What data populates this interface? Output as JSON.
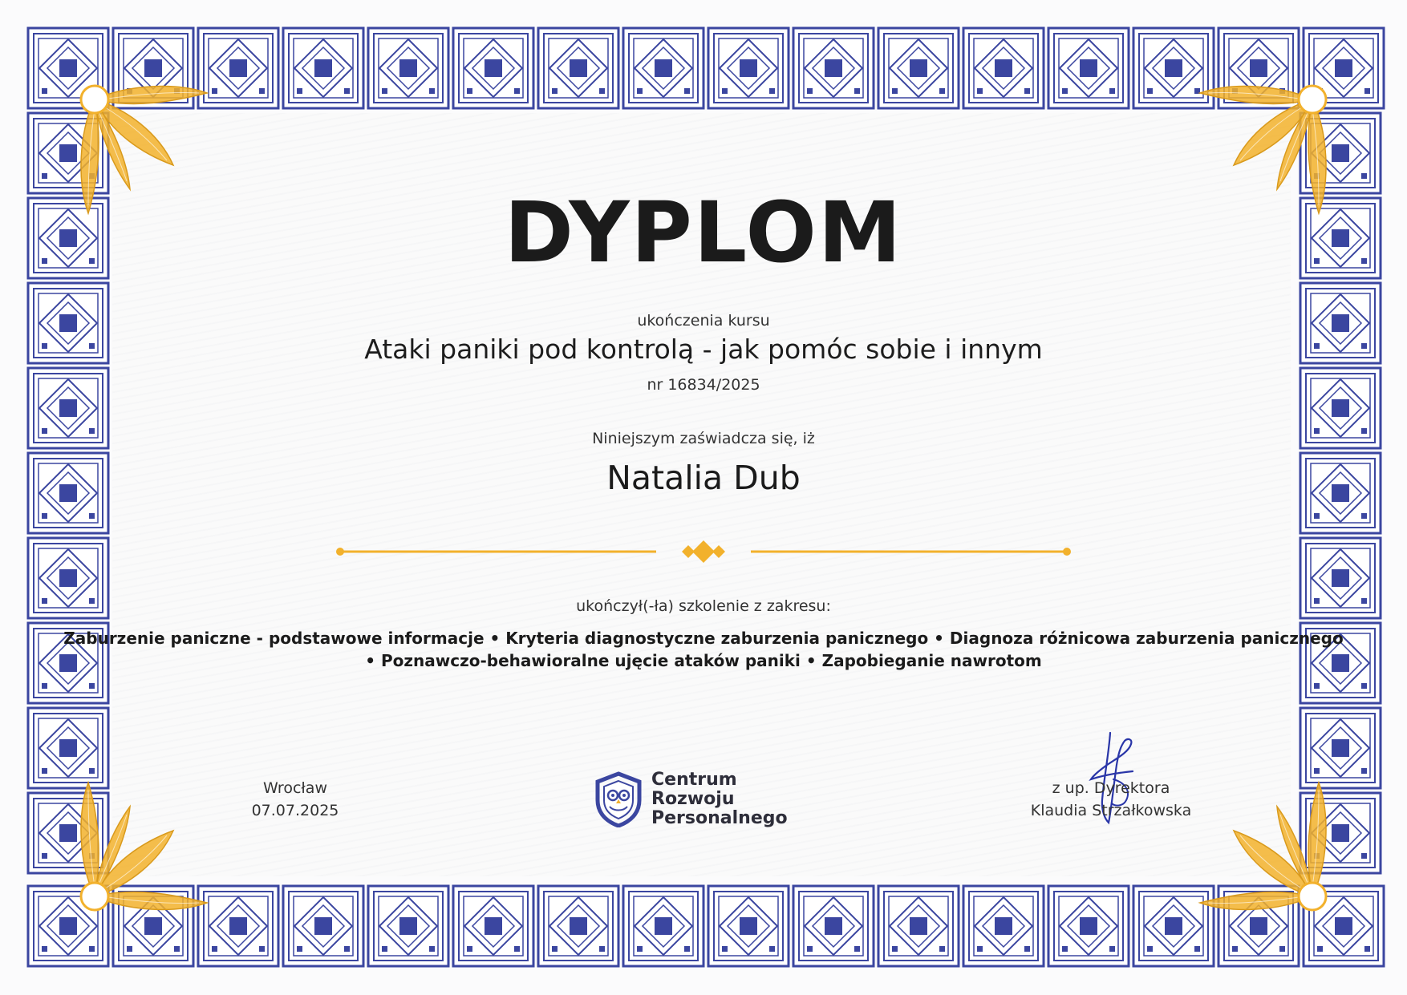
{
  "certificate": {
    "title": "DYPLOM",
    "course_label": "ukończenia kursu",
    "course_name": "Ataki paniki pod kontrolą - jak pomóc sobie i innym",
    "number": "nr 16834/2025",
    "certify_label": "Niniejszym zaświadcza się, iż",
    "recipient_name": "Natalia Dub",
    "completed_label": "ukończył(-ła) szkolenie z zakresu:",
    "topics_line1": "Zaburzenie paniczne - podstawowe informacje • Kryteria diagnostyczne zaburzenia panicznego • Diagnoza różnicowa zaburzenia panicznego",
    "topics_line2": "• Poznawczo-behawioralne ujęcie ataków paniki • Zapobieganie nawrotom"
  },
  "footer": {
    "city": "Wrocław",
    "date": "07.07.2025",
    "org_line1": "Centrum Rozwoju",
    "org_line2": "Personalnego",
    "signatory_role": "z up. Dyrektora",
    "signatory_name": "Klaudia Strzałkowska"
  },
  "colors": {
    "border_blue": "#3b46a0",
    "accent_gold": "#f2b12c",
    "text_dark": "#1b1b1b"
  },
  "icons": {
    "border_tile": "geometric-square-tile-icon",
    "corner": "golden-leaf-flower-icon",
    "logo": "owl-shield-logo-icon",
    "divider": "gold-diamond-divider-icon",
    "signature": "handwritten-signature"
  }
}
